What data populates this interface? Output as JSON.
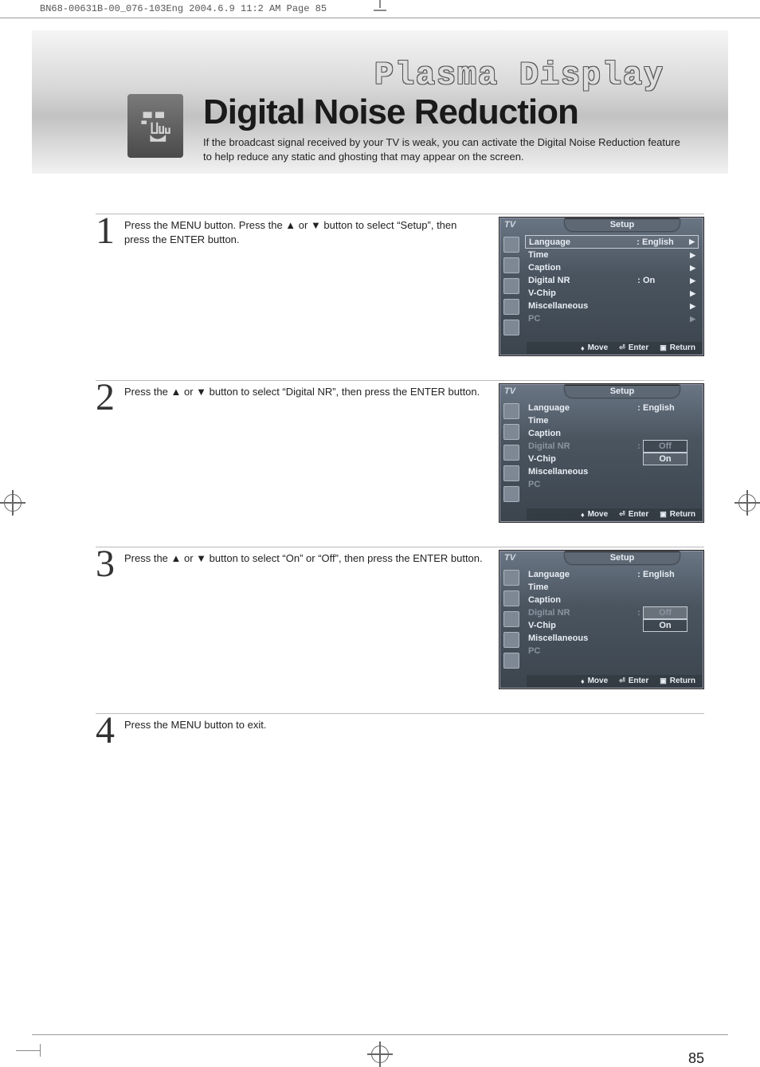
{
  "print_header": "BN68-00631B-00_076-103Eng  2004.6.9  11:2 AM  Page 85",
  "banner": {
    "brand_title": "Plasma Display",
    "section_title": "Digital Noise Reduction",
    "intro": "If the broadcast signal received by your TV is weak, you can activate the Digital Noise Reduction feature to help reduce any static and ghosting that may appear on the screen."
  },
  "steps": [
    {
      "num": "1",
      "desc": "Press the MENU button. Press the ▲ or ▼ button to select “Setup”, then press the ENTER button."
    },
    {
      "num": "2",
      "desc": "Press the ▲ or ▼ button to select “Digital NR”, then press the ENTER button."
    },
    {
      "num": "3",
      "desc": "Press the ▲ or ▼ button to select “On” or “Off”, then press the ENTER button."
    },
    {
      "num": "4",
      "desc": "Press the MENU button to exit."
    }
  ],
  "osd_common": {
    "tv_label": "TV",
    "title": "Setup",
    "rows": {
      "language": "Language",
      "time": "Time",
      "caption": "Caption",
      "digital_nr": "Digital NR",
      "vchip": "V-Chip",
      "misc": "Miscellaneous",
      "pc": "PC"
    },
    "values": {
      "language": "English",
      "digital_nr_on": "On",
      "opt_off": "Off",
      "opt_on": "On"
    },
    "footer": {
      "move": "Move",
      "enter": "Enter",
      "return": "Return"
    }
  },
  "page_number": "85"
}
